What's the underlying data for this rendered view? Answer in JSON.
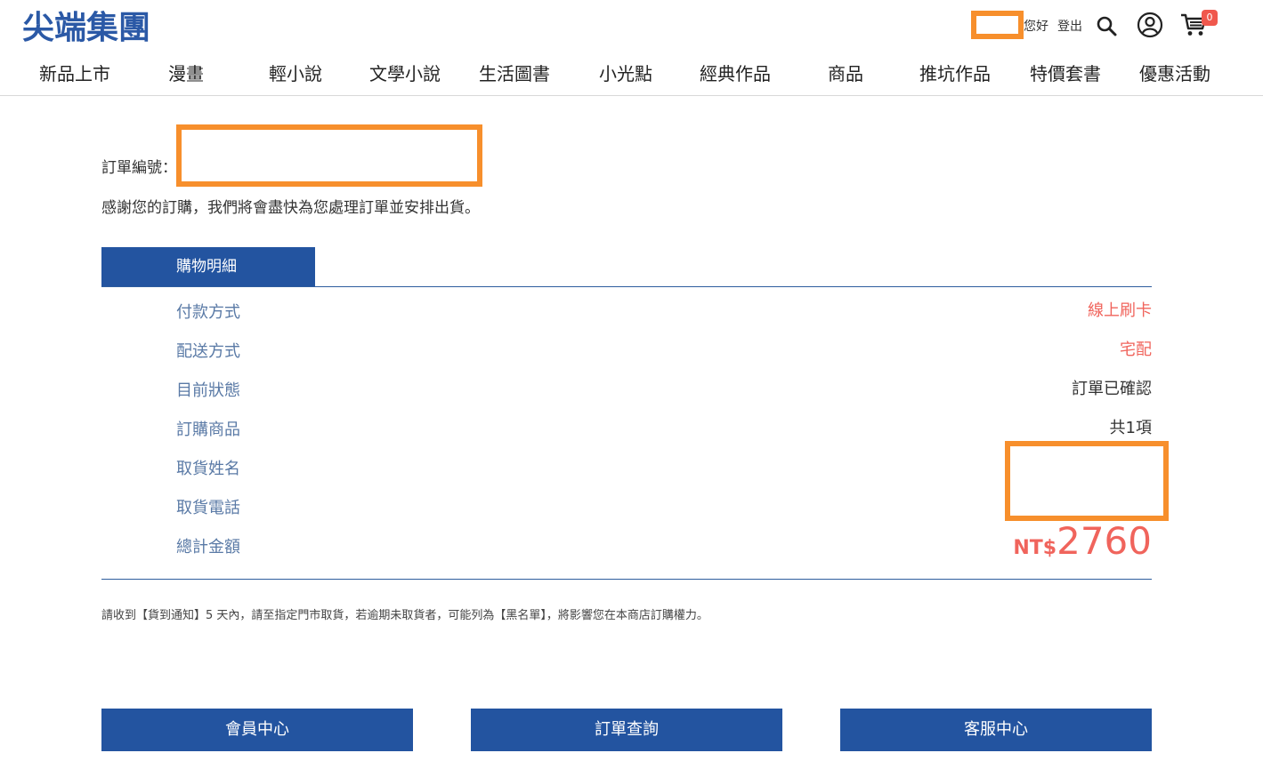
{
  "header": {
    "logo_text": "尖端集團",
    "greeting": "您好",
    "logout_label": "登出",
    "cart_count": "0"
  },
  "nav": {
    "items": [
      "新品上市",
      "漫畫",
      "輕小說",
      "文學小說",
      "生活圖書",
      "小光點",
      "經典作品",
      "商品",
      "推坑作品",
      "特價套書",
      "優惠活動"
    ]
  },
  "order": {
    "number_label": "訂單編號：",
    "thanks": "感謝您的訂購，我們將會盡快為您處理訂單並安排出貨。",
    "tab_label": "購物明細",
    "rows": [
      {
        "label": "付款方式",
        "value": "線上刷卡"
      },
      {
        "label": "配送方式",
        "value": "宅配"
      },
      {
        "label": "目前狀態",
        "value": "訂單已確認"
      },
      {
        "label": "訂購商品",
        "value": "共1項"
      },
      {
        "label": "取貨姓名",
        "value": ""
      },
      {
        "label": "取貨電話",
        "value": ""
      },
      {
        "label": "總計金額",
        "value": ""
      }
    ],
    "total_currency": "NT$",
    "total_amount": "2760",
    "notice": "請收到【貨到通知】5 天內，請至指定門市取貨，若逾期未取貨者，可能列為【黑名單】，將影響您在本商店訂購權力。"
  },
  "buttons": {
    "member": "會員中心",
    "order_query": "訂單查詢",
    "service": "客服中心"
  },
  "colors": {
    "brand_blue": "#2354a0",
    "accent_red": "#f0645c",
    "redaction_orange": "#f78f2c"
  }
}
